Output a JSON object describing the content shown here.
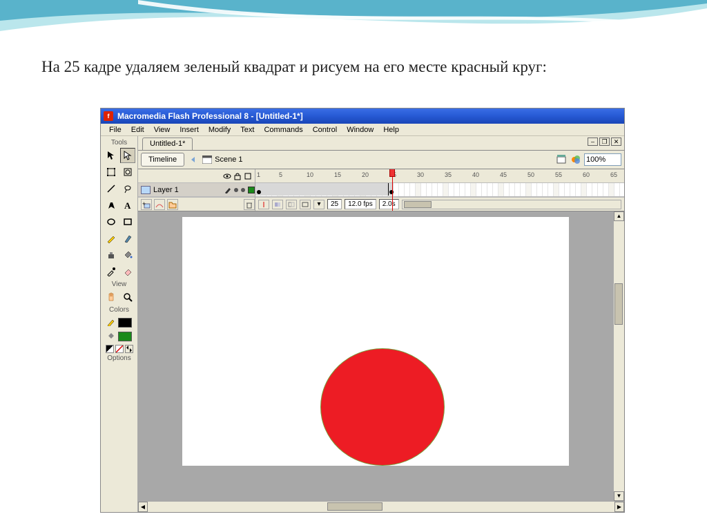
{
  "slide": {
    "heading": "На 25 кадре удаляем зеленый квадрат и рисуем на его месте красный круг:"
  },
  "window": {
    "title": "Macromedia Flash Professional 8 - [Untitled-1*]"
  },
  "menu": {
    "file": "File",
    "edit": "Edit",
    "view": "View",
    "insert": "Insert",
    "modify": "Modify",
    "text": "Text",
    "commands": "Commands",
    "control": "Control",
    "window": "Window",
    "help": "Help"
  },
  "tools": {
    "label": "Tools",
    "view_label": "View",
    "colors_label": "Colors",
    "options_label": "Options",
    "stroke_color": "#000000",
    "fill_color": "#1a8a1a"
  },
  "doc": {
    "tab_name": "Untitled-1*",
    "timeline_tab": "Timeline",
    "scene": "Scene 1",
    "zoom": "100%"
  },
  "timeline": {
    "layer_name": "Layer 1",
    "ruler_labels": [
      "1",
      "5",
      "10",
      "15",
      "20",
      "25",
      "30",
      "35",
      "40",
      "45",
      "50",
      "55",
      "60",
      "65"
    ],
    "current_frame": "25",
    "fps": "12.0 fps",
    "elapsed": "2.0s",
    "keyframes": {
      "start": 1,
      "end": 25
    }
  },
  "stage": {
    "circle": {
      "fill": "#ed1c24",
      "stroke": "#7a9a3a"
    }
  }
}
